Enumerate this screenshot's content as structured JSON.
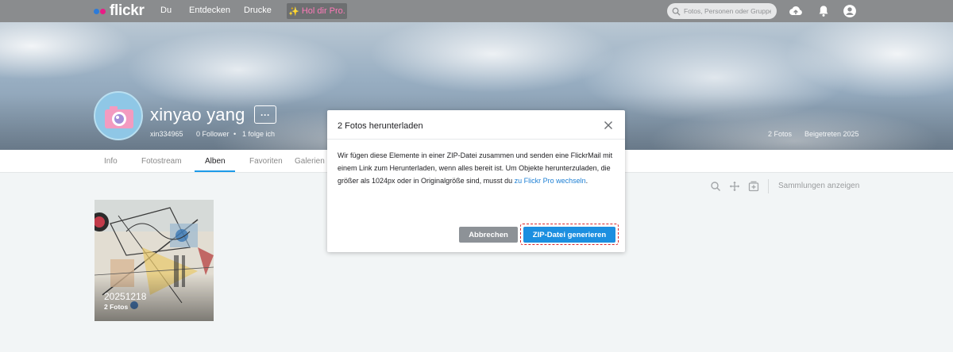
{
  "topnav": {
    "logo": "flickr",
    "links": [
      "Du",
      "Entdecken",
      "Drucke"
    ],
    "pro_label": "Hol dir Pro.",
    "search_placeholder": "Fotos, Personen oder Gruppen"
  },
  "profile": {
    "name": "xinyao yang",
    "more_label": "···",
    "handle": "xin334965",
    "followers": "0 Follower",
    "separator": "•",
    "following": "1 folge ich",
    "photos_count": "2 Fotos",
    "joined": "Beigetreten 2025"
  },
  "subnav": {
    "tabs": [
      "Info",
      "Fotostream",
      "Alben",
      "Favoriten",
      "Galerien"
    ],
    "active_tab": "Alben"
  },
  "toolbar": {
    "collections_label": "Sammlungen anzeigen"
  },
  "album": {
    "title": "20251218",
    "count": "2 Fotos"
  },
  "modal": {
    "title": "2 Fotos herunterladen",
    "body_text": "Wir fügen diese Elemente in einer ZIP-Datei zusammen und senden eine FlickrMail mit einem Link zum Herunterladen, wenn alles bereit ist. Um Objekte herunterzuladen, die größer als 1024px oder in Originalgröße sind, musst du ",
    "body_link": "zu Flickr Pro wechseln",
    "body_end": ".",
    "cancel_label": "Abbrechen",
    "generate_label": "ZIP-Datei generieren"
  },
  "colors": {
    "nav_bg": "#8a8c8e",
    "accent_blue": "#1c8fe0",
    "cancel_gray": "#8d9297",
    "highlight_red": "#d9262b",
    "pro_pink": "#ff7ab8"
  }
}
